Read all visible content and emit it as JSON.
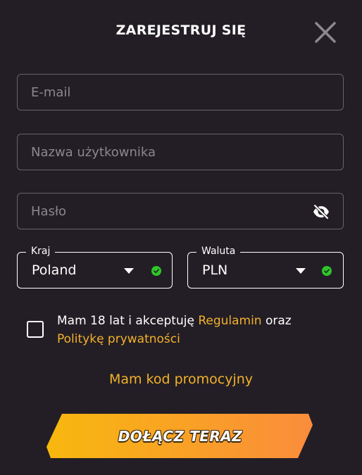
{
  "header": {
    "title": "ZAREJESTRUJ SIĘ",
    "close_icon": "close-icon"
  },
  "form": {
    "email": {
      "placeholder": "E-mail",
      "value": ""
    },
    "username": {
      "placeholder": "Nazwa użytkownika",
      "value": ""
    },
    "password": {
      "placeholder": "Hasło",
      "value": "",
      "toggle_icon": "eye-off-icon"
    },
    "country": {
      "legend": "Kraj",
      "value": "Poland",
      "status": "valid"
    },
    "currency": {
      "legend": "Waluta",
      "value": "PLN",
      "status": "valid"
    },
    "terms": {
      "checked": false,
      "text_before": "Mam 18 lat i akceptuję ",
      "regulamin_link": "Regulamin",
      "text_middle": " oraz ",
      "privacy_link": "Politykę prywatności"
    },
    "promo_link": "Mam kod promocyjny",
    "submit_label": "DOŁĄCZ TERAZ"
  },
  "colors": {
    "background": "#231e25",
    "accent": "#f2b12c",
    "valid": "#2ec62a",
    "button_gradient_start": "#f8b80e",
    "button_gradient_end": "#fa8c3c"
  }
}
